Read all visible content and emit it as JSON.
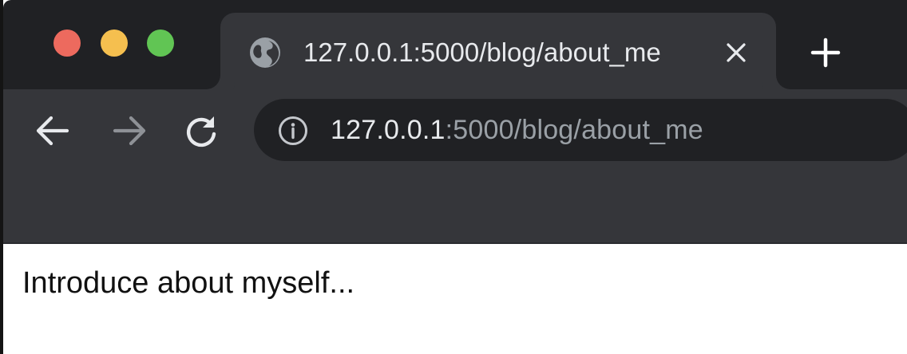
{
  "window": {
    "controls": [
      "close",
      "minimize",
      "maximize"
    ],
    "colors": {
      "close": "#ed6a5e",
      "minimize": "#f5bf4f",
      "maximize": "#61c554"
    }
  },
  "tab": {
    "title": "127.0.0.1:5000/blog/about_me",
    "icon": "globe-icon",
    "close_icon": "close-icon"
  },
  "toolbar": {
    "back_icon": "arrow-left-icon",
    "forward_icon": "arrow-right-icon",
    "reload_icon": "reload-icon",
    "new_tab_icon": "plus-icon"
  },
  "address_bar": {
    "security_icon": "info-icon",
    "host": "127.0.0.1",
    "rest": ":5000/blog/about_me"
  },
  "page": {
    "text": "Introduce about myself..."
  }
}
